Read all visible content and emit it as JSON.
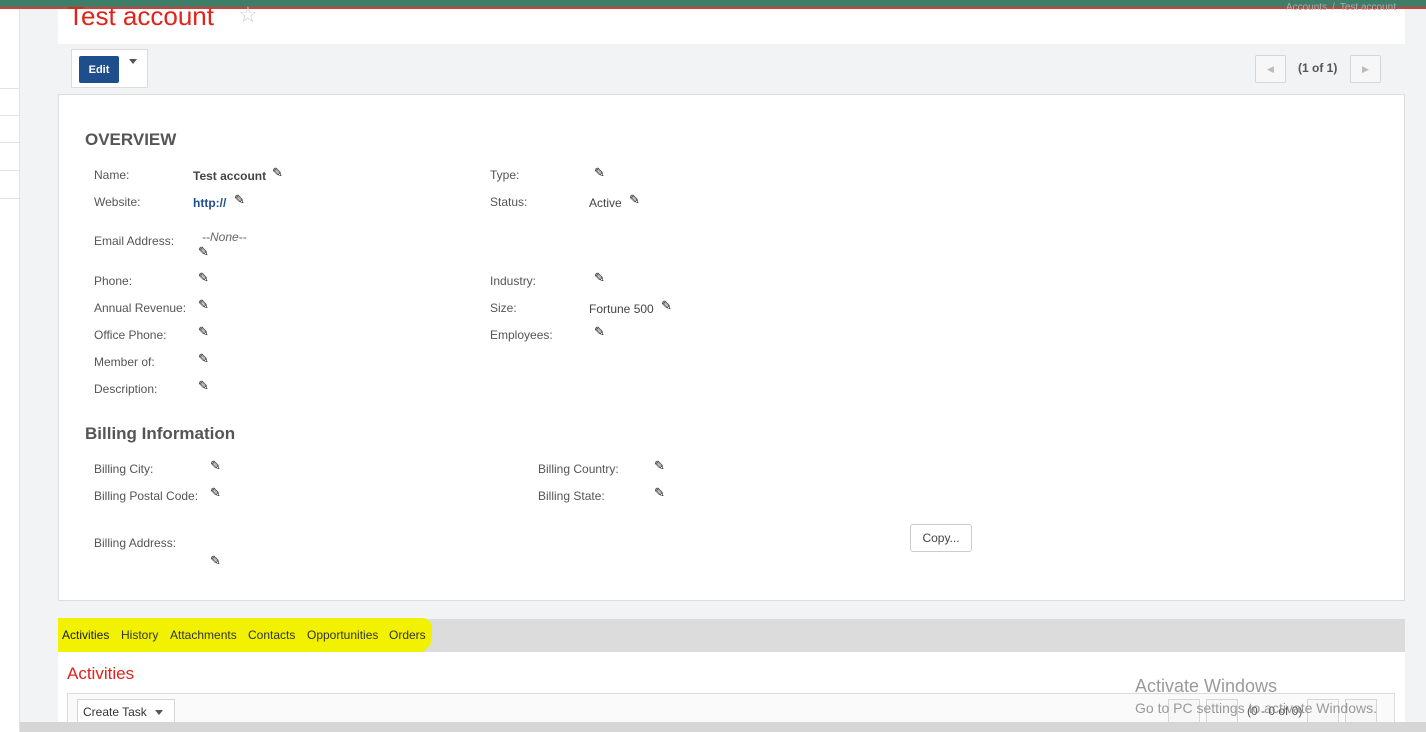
{
  "header": {
    "title": "Test account",
    "breadcrumb": [
      "Accounts",
      "Test account"
    ],
    "breadcrumb_sep": "/"
  },
  "actions": {
    "edit_label": "Edit"
  },
  "pager": {
    "text": "(1 of 1)"
  },
  "overview": {
    "title": "OVERVIEW",
    "name_label": "Name:",
    "name_value": "Test account",
    "type_label": "Type:",
    "website_label": "Website:",
    "website_value": "http://",
    "status_label": "Status:",
    "status_value": "Active",
    "email_label": "Email Address:",
    "email_value": "--None--",
    "phone_label": "Phone:",
    "industry_label": "Industry:",
    "annual_revenue_label": "Annual Revenue:",
    "size_label": "Size:",
    "size_value": "Fortune 500",
    "office_phone_label": "Office Phone:",
    "employees_label": "Employees:",
    "member_of_label": "Member of:",
    "description_label": "Description:"
  },
  "billing": {
    "title": "Billing Information",
    "city_label": "Billing City:",
    "country_label": "Billing Country:",
    "postal_label": "Billing Postal Code:",
    "state_label": "Billing State:",
    "address_label": "Billing Address:",
    "copy_label": "Copy..."
  },
  "tabs": [
    {
      "label": "Activities"
    },
    {
      "label": "History"
    },
    {
      "label": "Attachments"
    },
    {
      "label": "Contacts"
    },
    {
      "label": "Opportunities"
    },
    {
      "label": "Orders"
    }
  ],
  "activities": {
    "title": "Activities",
    "create_task_label": "Create Task",
    "pager_text": "(0 - 0 of 0)"
  },
  "watermark": {
    "line1": "Activate Windows",
    "line2": "Go to PC settings to activate Windows."
  },
  "icons": {
    "edit_pencil": "pencil-icon",
    "favorite": "star-icon"
  },
  "colors": {
    "brand_red": "#e2231a",
    "edit_blue": "#1f4e8c",
    "highlight": "#f2f200"
  }
}
